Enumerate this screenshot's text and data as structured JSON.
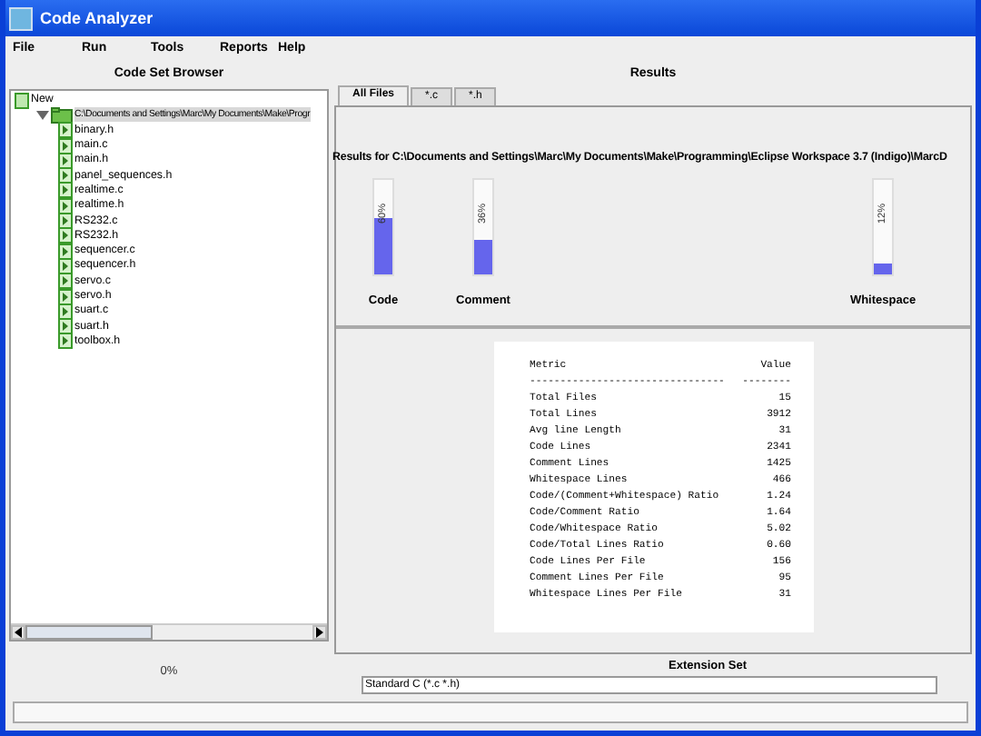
{
  "window": {
    "title": "Code Analyzer"
  },
  "menu": [
    "File",
    "Run",
    "Tools",
    "Reports",
    "Help"
  ],
  "browser": {
    "heading": "Code Set Browser",
    "tree": [
      {
        "label": "New",
        "kind": "new",
        "children": [
          {
            "label": "C:\\Documents and Settings\\Marc\\My Documents\\Make\\Progr",
            "kind": "folder",
            "expanded": true,
            "selected": true,
            "children": [
              {
                "label": "binary.h",
                "kind": "file"
              },
              {
                "label": "main.c",
                "kind": "file"
              },
              {
                "label": "main.h",
                "kind": "file"
              },
              {
                "label": "panel_sequences.h",
                "kind": "file"
              },
              {
                "label": "realtime.c",
                "kind": "file"
              },
              {
                "label": "realtime.h",
                "kind": "file"
              },
              {
                "label": "RS232.c",
                "kind": "file"
              },
              {
                "label": "RS232.h",
                "kind": "file"
              },
              {
                "label": "sequencer.c",
                "kind": "file"
              },
              {
                "label": "sequencer.h",
                "kind": "file"
              },
              {
                "label": "servo.c",
                "kind": "file"
              },
              {
                "label": "servo.h",
                "kind": "file"
              },
              {
                "label": "suart.c",
                "kind": "file"
              },
              {
                "label": "suart.h",
                "kind": "file"
              },
              {
                "label": "toolbox.h",
                "kind": "file"
              }
            ]
          }
        ]
      }
    ]
  },
  "results": {
    "heading": "Results",
    "tabs": [
      {
        "label": "All Files",
        "selected": true
      },
      {
        "label": "*.c",
        "selected": false
      },
      {
        "label": "*.h",
        "selected": false
      }
    ],
    "path": "Results for C:\\Documents and Settings\\Marc\\My Documents\\Make\\Programming\\Eclipse Workspace 3.7 (Indigo)\\MarcD",
    "bars": [
      {
        "label": "Code",
        "reading": "60%",
        "level": 0.6
      },
      {
        "label": "Comment",
        "reading": "36%",
        "level": 0.36
      },
      {
        "label": "Whitespace",
        "reading": "12%",
        "level": 0.12
      }
    ],
    "report": {
      "columns": [
        "Metric",
        "Value"
      ],
      "rules": [
        "--------------------------------",
        "--------"
      ],
      "rows": [
        [
          "Total Files",
          "15"
        ],
        [
          "Total Lines",
          "3912"
        ],
        [
          "Avg line Length",
          "31"
        ],
        [
          "Code Lines",
          "2341"
        ],
        [
          "Comment Lines",
          "1425"
        ],
        [
          "Whitespace Lines",
          "466"
        ],
        [
          "Code/(Comment+Whitespace) Ratio",
          "1.24"
        ],
        [
          "Code/Comment Ratio",
          "1.64"
        ],
        [
          "Code/Whitespace Ratio",
          "5.02"
        ],
        [
          "Code/Total Lines Ratio",
          "0.60"
        ],
        [
          "Code Lines Per File",
          "156"
        ],
        [
          "Comment Lines Per File",
          "95"
        ],
        [
          "Whitespace Lines Per File",
          "31"
        ]
      ]
    }
  },
  "progress": {
    "reading": "0%"
  },
  "extension_set": {
    "heading": "Extension Set",
    "value": "Standard C (*.c *.h)"
  }
}
